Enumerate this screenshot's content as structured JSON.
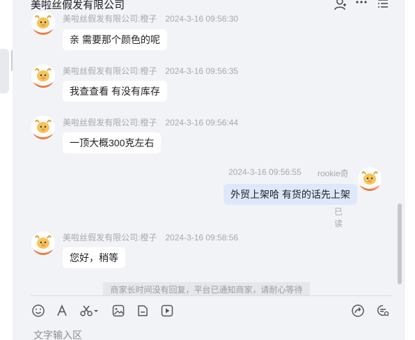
{
  "header": {
    "title": "美啦丝假发有限公司"
  },
  "messages": [
    {
      "side": "left",
      "sender": "美啦丝假发有限公司:橙子",
      "time": "2024-3-16 09:56:30",
      "text": "亲 需要那个颜色的呢"
    },
    {
      "side": "left",
      "sender": "美啦丝假发有限公司:橙子",
      "time": "2024-3-16 09:56:35",
      "text": "我查查看 有没有库存"
    },
    {
      "side": "left",
      "sender": "美啦丝假发有限公司:橙子",
      "time": "2024-3-16 09:56:44",
      "text": "一顶大概300克左右"
    },
    {
      "side": "right",
      "sender": "rookie奇",
      "time": "2024-3-16 09:56:55",
      "text": "外贸上架哈 有货的话先上架",
      "status": "已读"
    },
    {
      "side": "left",
      "sender": "美啦丝假发有限公司:橙子",
      "time": "2024-3-16 09:58:56",
      "text": "您好，稍等"
    }
  ],
  "notice": "商家长时间没有回复，平台已通知商家，请耐心等待",
  "input": {
    "placeholder": "文字输入区"
  },
  "toolbar": [
    "emoji-icon",
    "font-icon",
    "scissors-icon",
    "image-icon",
    "file-icon",
    "video-icon",
    "share-icon",
    "settings-chat-icon"
  ],
  "header_icons": [
    "add-user-icon",
    "more-icon",
    "list-icon"
  ],
  "colors": {
    "background": "#f2f3f7",
    "bubble_left": "#ffffff",
    "bubble_right": "#dde8fb",
    "avatar_orange": "#f07a3c"
  }
}
